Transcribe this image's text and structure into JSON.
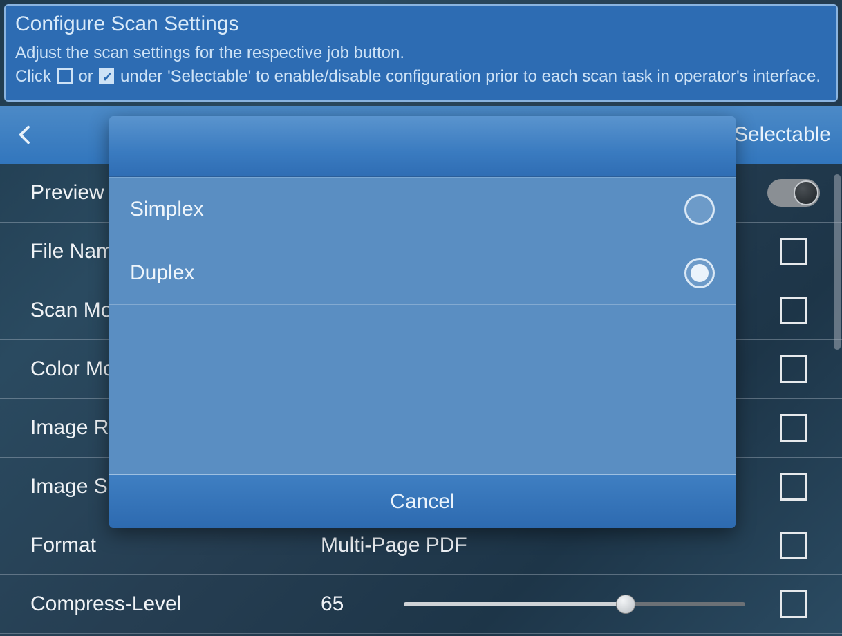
{
  "header": {
    "title": "Configure Scan Settings",
    "line1": "Adjust the scan settings for the respective job button.",
    "line2_pre": "Click ",
    "line2_mid": " or ",
    "line2_post": " under 'Selectable' to enable/disable configuration prior to each scan task in operator's interface."
  },
  "toolbar": {
    "selectable_label": "Selectable"
  },
  "rows": {
    "preview": {
      "label": "Preview",
      "value": ""
    },
    "filename": {
      "label": "File Name",
      "value": ""
    },
    "scanmode": {
      "label": "Scan Mode",
      "value": ""
    },
    "colormode": {
      "label": "Color Mode",
      "value": ""
    },
    "imageres": {
      "label": "Image Resolution",
      "value": ""
    },
    "imagesize": {
      "label": "Image Size",
      "value": ""
    },
    "format": {
      "label": "Format",
      "value": "Multi-Page PDF"
    },
    "compress": {
      "label": "Compress-Level",
      "value": "65"
    }
  },
  "modal": {
    "options": {
      "simplex": "Simplex",
      "duplex": "Duplex"
    },
    "cancel": "Cancel"
  }
}
